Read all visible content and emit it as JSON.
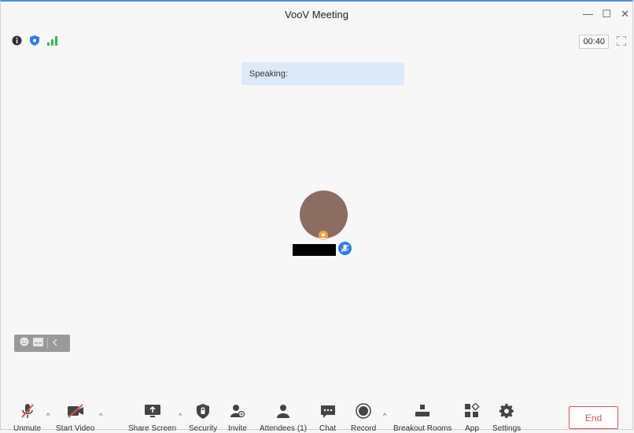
{
  "window": {
    "title": "VooV Meeting",
    "minimize": "—",
    "maximize": "☐",
    "close": "✕"
  },
  "status": {
    "timer": "00:40"
  },
  "banner": {
    "speaking": "Speaking:"
  },
  "toolbar": {
    "unmute": "Unmute",
    "start_video": "Start Video",
    "share_screen": "Share Screen",
    "security": "Security",
    "invite": "Invite",
    "attendees": "Attendees (1)",
    "chat": "Chat",
    "record": "Record",
    "breakout_rooms": "Breakout Rooms",
    "app": "App",
    "settings": "Settings",
    "end": "End"
  },
  "colors": {
    "accent": "#2f7be7",
    "end": "#e05252",
    "avatar": "#8c6d62",
    "signal": "#3cb54a"
  }
}
